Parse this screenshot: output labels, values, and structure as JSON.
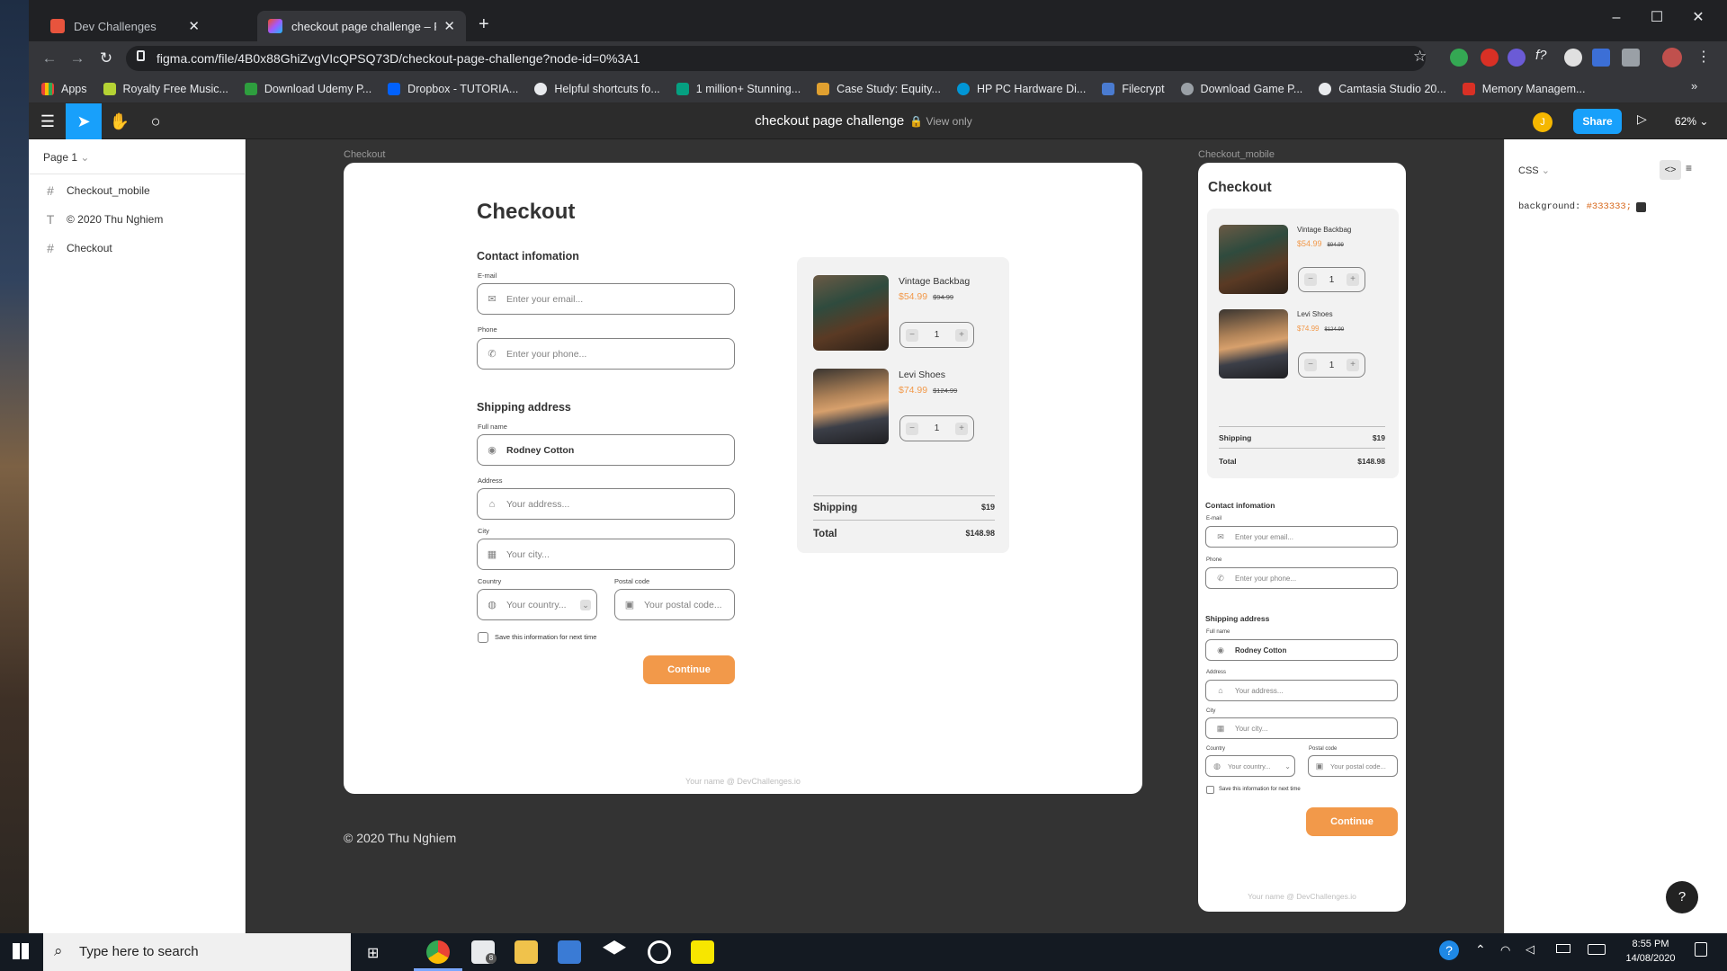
{
  "browser": {
    "tabs": [
      {
        "title": "Dev Challenges",
        "active": false
      },
      {
        "title": "checkout page challenge – Figma",
        "active": true
      }
    ],
    "new_tab": "+",
    "url": "figma.com/file/4B0x88GhiZvgVIcQPSQ73D/checkout-page-challenge?node-id=0%3A1",
    "bookmarks": [
      "Apps",
      "Royalty Free Music...",
      "Download Udemy P...",
      "Dropbox - TUTORIA...",
      "Helpful shortcuts fo...",
      "1 million+ Stunning...",
      "Case Study: Equity...",
      "HP PC Hardware Di...",
      "Filecrypt",
      "Download Game P...",
      "Camtasia Studio 20...",
      "Memory Managem..."
    ]
  },
  "figma": {
    "file_title": "checkout page challenge",
    "view_only": "View only",
    "share": "Share",
    "zoom": "62%",
    "avatar_initial": "J",
    "page": "Page 1",
    "layers": [
      {
        "icon": "#",
        "name": "Checkout_mobile"
      },
      {
        "icon": "T",
        "name": "© 2020 Thu Nghiem"
      },
      {
        "icon": "#",
        "name": "Checkout"
      }
    ],
    "panel_mode": "CSS",
    "css_prop": "background:",
    "css_value": "#333333;",
    "help": "?"
  },
  "canvas": {
    "frame_desktop_label": "Checkout",
    "frame_mobile_label": "Checkout_mobile",
    "copyright": "© 2020 Thu Nghiem"
  },
  "checkout": {
    "title": "Checkout",
    "contact_heading": "Contact infomation",
    "email_label": "E-mail",
    "email_placeholder": "Enter your email...",
    "phone_label": "Phone",
    "phone_placeholder": "Enter your phone...",
    "shipping_heading": "Shipping address",
    "fullname_label": "Full name",
    "fullname_value": "Rodney Cotton",
    "address_label": "Address",
    "address_placeholder": "Your address...",
    "city_label": "City",
    "city_placeholder": "Your city...",
    "country_label": "Country",
    "country_placeholder": "Your country...",
    "postal_label": "Postal code",
    "postal_placeholder": "Your postal code...",
    "save_info": "Save this information for next time",
    "continue": "Continue",
    "footer": "Your name @ DevChallenges.io",
    "products": [
      {
        "name": "Vintage Backbag",
        "price": "$54.99",
        "old_price": "$94.99",
        "qty": "1"
      },
      {
        "name": "Levi Shoes",
        "price": "$74.99",
        "old_price": "$124.99",
        "qty": "1"
      }
    ],
    "shipping_label": "Shipping",
    "shipping_value": "$19",
    "total_label": "Total",
    "total_value": "$148.98"
  },
  "taskbar": {
    "search_placeholder": "Type here to search",
    "time": "8:55 PM",
    "date": "14/08/2020",
    "mail_badge": "8"
  },
  "colors": {
    "accent": "#f2994a",
    "figma_blue": "#18a0fb",
    "canvas_bg": "#333333"
  }
}
